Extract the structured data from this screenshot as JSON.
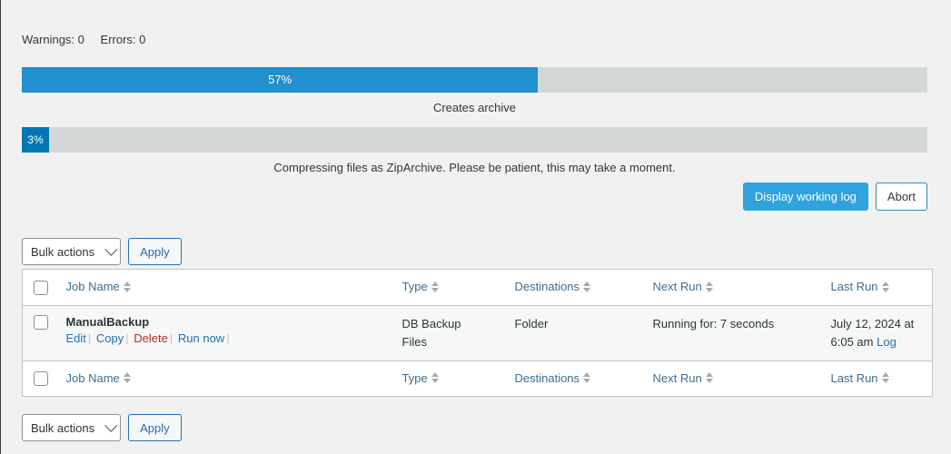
{
  "status": {
    "warnings_label": "Warnings: 0",
    "errors_label": "Errors: 0"
  },
  "progress": {
    "overall": {
      "percent_label": "57%",
      "percent": 57,
      "caption": "Creates archive",
      "fill_color": "#2090ce",
      "track_color": "#d4d7d7"
    },
    "step": {
      "percent_label": "3%",
      "percent": 3,
      "caption": "Compressing files as ZipArchive. Please be patient, this may take a moment.",
      "fill_color": "#0077b3",
      "track_color": "#d4d7d7"
    }
  },
  "actions": {
    "display_log_label": "Display working log",
    "abort_label": "Abort",
    "primary_color": "#2ea3dd"
  },
  "tablenav": {
    "bulk_actions_label": "Bulk actions",
    "apply_label": "Apply",
    "chevron_icon": "chevron-down-icon"
  },
  "table": {
    "columns": [
      {
        "label": "Job Name"
      },
      {
        "label": "Type"
      },
      {
        "label": "Destinations"
      },
      {
        "label": "Next Run"
      },
      {
        "label": "Last Run"
      }
    ],
    "rows": [
      {
        "name": "ManualBackup",
        "row_actions": [
          {
            "label": "Edit",
            "style": "normal"
          },
          {
            "label": "Copy",
            "style": "normal"
          },
          {
            "label": "Delete",
            "style": "danger"
          },
          {
            "label": "Run now",
            "style": "normal"
          }
        ],
        "type": "DB Backup\nFiles",
        "destinations": "Folder",
        "next_run": "Running for: 7 seconds",
        "last_run": "July 12, 2024 at 6:05 am",
        "last_run_link": "Log"
      }
    ]
  }
}
